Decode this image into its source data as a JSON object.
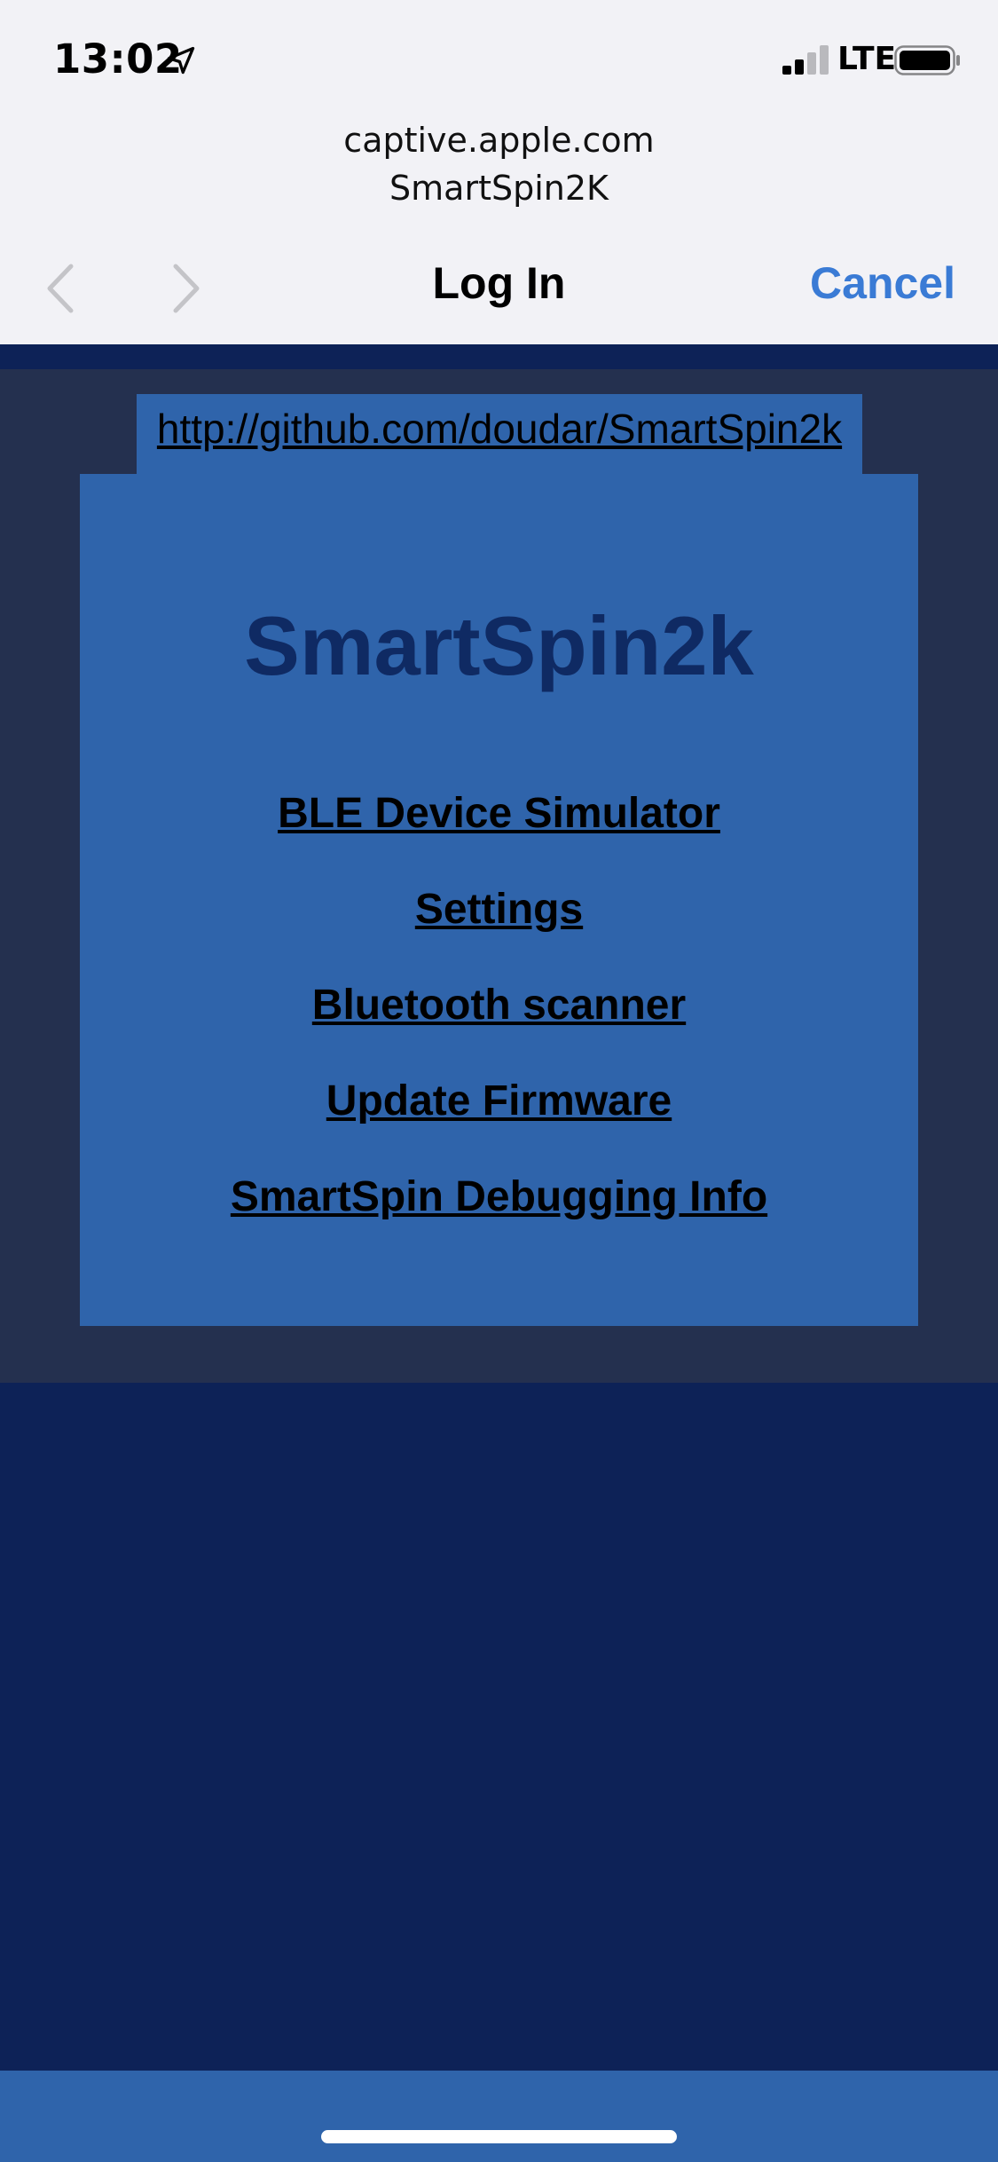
{
  "status_bar": {
    "time": "13:02",
    "carrier": "LTE",
    "icons": [
      "location-arrow-icon",
      "cellular-signal-icon",
      "battery-icon"
    ]
  },
  "portal_header": {
    "url": "captive.apple.com",
    "network_name": "SmartSpin2K",
    "title": "Log In",
    "cancel_label": "Cancel",
    "icons": [
      "chevron-left-icon",
      "chevron-right-icon"
    ]
  },
  "page": {
    "repo_link": "http://github.com/doudar/SmartSpin2k",
    "site_title": "SmartSpin2k",
    "links": [
      "BLE Device Simulator",
      "Settings",
      "Bluetooth scanner",
      "Update Firmware",
      "SmartSpin Debugging Info"
    ]
  },
  "colors": {
    "header_bg": "#f2f2f6",
    "accent_blue": "#3a7bd5",
    "page_dark_bg": "#0d2257",
    "body_bg": "#24304f",
    "card_bg": "#2f64ab",
    "title_color": "#0f2a63"
  }
}
